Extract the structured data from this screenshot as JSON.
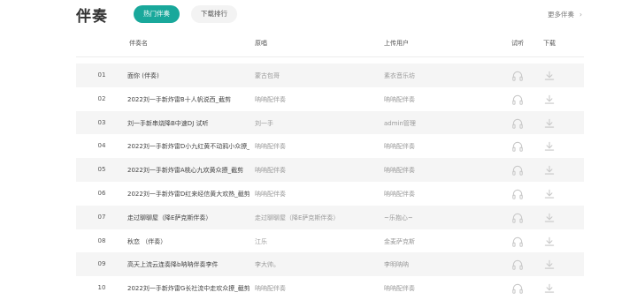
{
  "header": {
    "title": "伴奏",
    "tabs": [
      {
        "label": "热门伴奏",
        "active": true
      },
      {
        "label": "下载排行",
        "active": false
      }
    ],
    "more_label": "更多伴奏"
  },
  "table": {
    "columns": [
      "伴奏名",
      "原唱",
      "上传用户",
      "试听",
      "下载"
    ],
    "rows": [
      {
        "no": "01",
        "name": "面你 (伴奏)",
        "artist": "蒙古包哥",
        "uploader": "素衣音乐坊"
      },
      {
        "no": "02",
        "name": "2022刘一手新炸雷B十人帆说西_截剪",
        "artist": "呐呐配伴奏",
        "uploader": "呐呐配伴奏"
      },
      {
        "no": "03",
        "name": "刘一手新串烧降B中速DJ 试听",
        "artist": "刘一手",
        "uploader": "admin管理"
      },
      {
        "no": "04",
        "name": "2022刘一手新炸雷D小九红黄不动鸦小众撩_截剪",
        "artist": "呐呐配伴奏",
        "uploader": "呐呐配伴奏"
      },
      {
        "no": "05",
        "name": "2022刘一手新炸雷A桃心九欢黄众撩_截剪",
        "artist": "呐呐配伴奏",
        "uploader": "呐呐配伴奏"
      },
      {
        "no": "06",
        "name": "2022刘一手新炸雷D红来经信黄大欢热_截剪",
        "artist": "呐呐配伴奏",
        "uploader": "呐呐配伴奏"
      },
      {
        "no": "07",
        "name": "走过聊聊屋（降E萨克斯伴奏）",
        "artist": "走过聊聊屋（降E萨克斯伴奏）",
        "uploader": "~乐抱心~"
      },
      {
        "no": "08",
        "name": "秋恋 （伴奏）",
        "artist": "江乐",
        "uploader": "金麦萨克斯"
      },
      {
        "no": "09",
        "name": "高天上流云连奏降b呐呐伴奏李件",
        "artist": "李大帅。",
        "uploader": "李明呐呐"
      },
      {
        "no": "10",
        "name": "2022刘一手新炸雷G长社流中走欢众撩_截剪",
        "artist": "呐呐配伴奏",
        "uploader": "呐呐配伴奏"
      }
    ]
  },
  "icons": {
    "play": "headphones-icon",
    "download": "download-icon",
    "more": "chevron-right-icon"
  },
  "colors": {
    "accent": "#19a89b",
    "row_alt": "#f5f5f5",
    "icon": "#c8c8c8"
  }
}
